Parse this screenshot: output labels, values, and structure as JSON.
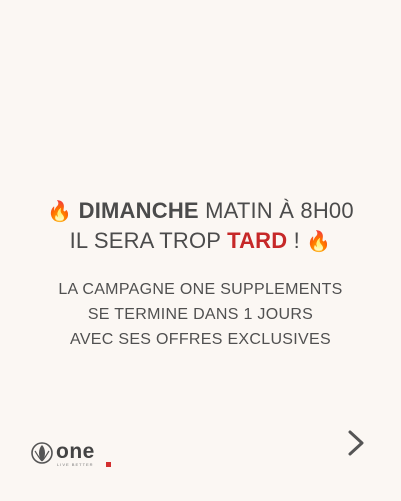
{
  "headline": {
    "line1_emoji": "🔥",
    "line1_bold": "DIMANCHE",
    "line1_rest": " MATIN À 8H00",
    "line2_start": "IL SERA TROP ",
    "line2_red": "TARD",
    "line2_end": " ! ",
    "line2_emoji": "🔥"
  },
  "body": {
    "line1": "LA CAMPAGNE ONE SUPPLEMENTS",
    "line2": "SE TERMINE DANS 1 JOURS",
    "line3": "AVEC SES OFFRES EXCLUSIVES"
  },
  "logo": {
    "wordmark": "one",
    "tagline": "LIVE BETTER"
  },
  "navigation": {
    "next_icon": "chevron-right-icon"
  },
  "colors": {
    "background": "#fbf7f3",
    "text": "#4b4b4b",
    "accent_red": "#c62828"
  }
}
